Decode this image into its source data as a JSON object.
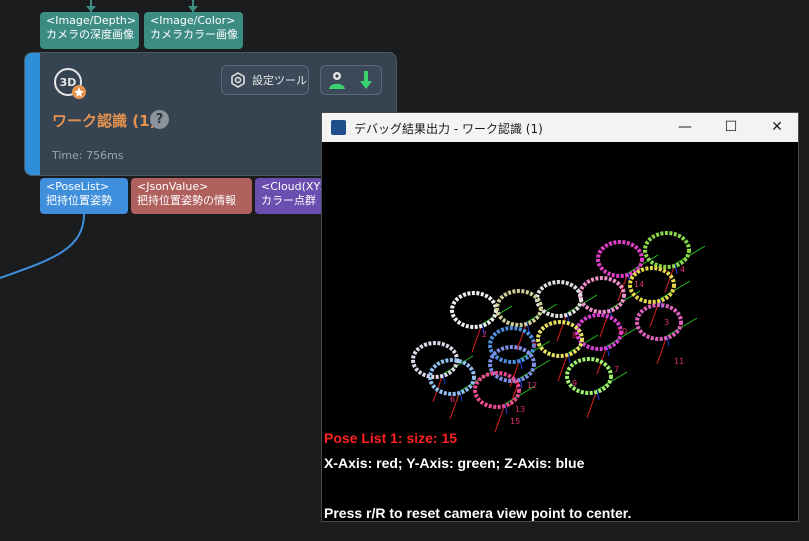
{
  "inputs": [
    {
      "type": "<Image/Depth>",
      "label": "カメラの深度画像"
    },
    {
      "type": "<Image/Color>",
      "label": "カメラカラー画像"
    }
  ],
  "node": {
    "title": "ワーク認識 (1)",
    "help": "?",
    "time": "Time: 756ms",
    "settings_label": "設定ツール"
  },
  "outputs": [
    {
      "type": "<PoseList>",
      "label": "把持位置姿勢"
    },
    {
      "type": "<JsonValue>",
      "label": "把持位置姿勢の情報"
    },
    {
      "type": "<Cloud(XYZ-",
      "label": "カラー点群"
    }
  ],
  "colors": {
    "canvas": "#1b1c1e",
    "input_port": "#3c8c84",
    "poselist_port": "#3f8fdc",
    "json_port": "#b0605c",
    "cloud_port": "#6a4fb0",
    "node_accent": "#2f8fd6",
    "title_orange": "#e6924f"
  },
  "window": {
    "title": "デバッグ結果出力 - ワーク認識 (1)",
    "minimize": "—",
    "maximize": "☐",
    "close": "✕",
    "pose_text": "Pose List 1: size: 15",
    "axis_text": "X-Axis: red; Y-Axis: green; Z-Axis: blue",
    "reset_text": "Press r/R to reset camera view point to center."
  },
  "pose_labels": [
    "4",
    "14",
    "2",
    "3",
    "10",
    "8",
    "5",
    "11",
    "7",
    "12",
    "9",
    "13",
    "6",
    "15"
  ],
  "rings": [
    {
      "color": "#8ad84a"
    },
    {
      "color": "#e040c8"
    },
    {
      "color": "#f0f0f0"
    },
    {
      "color": "#e6d84a"
    },
    {
      "color": "#f090c8"
    },
    {
      "color": "#e0e0e0"
    },
    {
      "color": "#cfcf9a"
    },
    {
      "color": "#e060c0"
    },
    {
      "color": "#d840d0"
    },
    {
      "color": "#5090e0"
    },
    {
      "color": "#e8e060"
    },
    {
      "color": "#8090e8"
    },
    {
      "color": "#e0d8e8"
    },
    {
      "color": "#f04a90"
    },
    {
      "color": "#a0f070"
    },
    {
      "color": "#90c0f0"
    }
  ]
}
